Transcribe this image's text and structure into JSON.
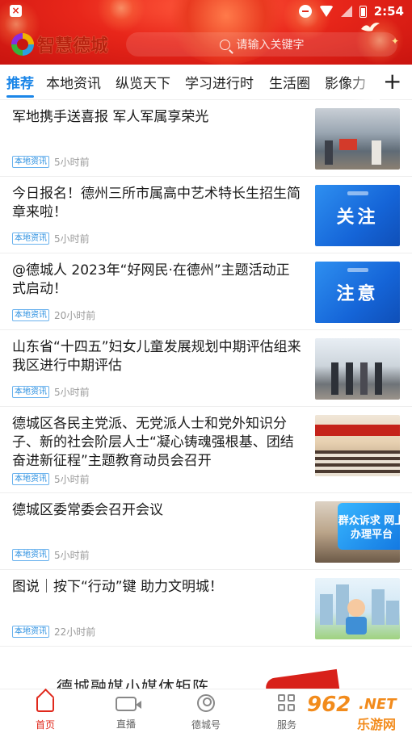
{
  "status_bar": {
    "time": "2:54"
  },
  "header": {
    "logo_text": "智慧德城",
    "search_placeholder": "请输入关键字"
  },
  "tabs": [
    {
      "label": "推荐",
      "active": true
    },
    {
      "label": "本地资讯"
    },
    {
      "label": "纵览天下"
    },
    {
      "label": "学习进行时"
    },
    {
      "label": "生活圈"
    },
    {
      "label": "影像力"
    }
  ],
  "add_tab_label": "+",
  "feed": [
    {
      "title": "军地携手送喜报  军人军属享荣光",
      "tag": "本地资讯",
      "time": "5小时前"
    },
    {
      "title": "今日报名！德州三所市属高中艺术特长生招生简章来啦！",
      "tag": "本地资讯",
      "time": "5小时前",
      "thumb_text": "关注"
    },
    {
      "title": "@德城人  2023年“好网民·在德州”主题活动正式启动！",
      "tag": "本地资讯",
      "time": "20小时前",
      "thumb_text": "注意"
    },
    {
      "title": "山东省“十四五”妇女儿童发展规划中期评估组来我区进行中期评估",
      "tag": "本地资讯",
      "time": "5小时前"
    },
    {
      "title": "德城区各民主党派、无党派人士和党外知识分子、新的社会阶层人士“凝心铸魂强根基、团结奋进新征程”主题教育动员会召开",
      "tag": "本地资讯",
      "time": "5小时前"
    },
    {
      "title": "德城区委常委会召开会议",
      "tag": "本地资讯",
      "time": "5小时前",
      "thumb_text": "群众诉求 网上办理平台"
    },
    {
      "title": "图说｜按下“行动”键  助力文明城！",
      "tag": "本地资讯",
      "time": "22小时前"
    }
  ],
  "ad": {
    "text": "德城融媒小媒体矩阵"
  },
  "bottom_nav": [
    {
      "label": "首页",
      "icon": "home-icon",
      "active": true
    },
    {
      "label": "直播",
      "icon": "video-icon"
    },
    {
      "label": "德城号",
      "icon": "person-icon"
    },
    {
      "label": "服务",
      "icon": "grid-icon"
    }
  ],
  "watermark": {
    "num": "962",
    "net": ".NET",
    "cn": "乐游网"
  },
  "colors": {
    "header_red": "#e8261a",
    "accent_blue": "#1b86e8",
    "nav_active_red": "#e0281b"
  }
}
